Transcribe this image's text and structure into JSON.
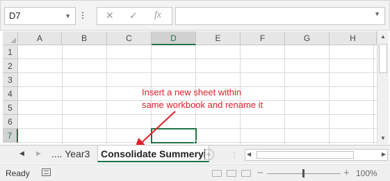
{
  "formula_bar": {
    "name_box": "D7",
    "cancel_icon": "✕",
    "enter_icon": "✓",
    "fx_label": "fx",
    "formula_value": ""
  },
  "grid": {
    "columns": [
      "A",
      "B",
      "C",
      "D",
      "E",
      "F",
      "G",
      "H"
    ],
    "rows": [
      "1",
      "2",
      "3",
      "4",
      "5",
      "6",
      "7"
    ],
    "active_cell": "D7"
  },
  "annotation": {
    "line1": "Insert a new sheet within",
    "line2": "same workbook and rename it",
    "color": "#e0202a"
  },
  "sheet_tabs": {
    "prev_icon": "◀",
    "next_icon": "▶",
    "tabs": [
      "Year3",
      "Consolidate Summery"
    ],
    "ellipsis": "....",
    "active": "Consolidate Summery",
    "add_icon": "+",
    "scroll_dots": "⋮"
  },
  "status_bar": {
    "ready": "Ready",
    "zoom_minus": "−",
    "zoom_plus": "+",
    "zoom": "100%"
  },
  "accent_color": "#217346"
}
